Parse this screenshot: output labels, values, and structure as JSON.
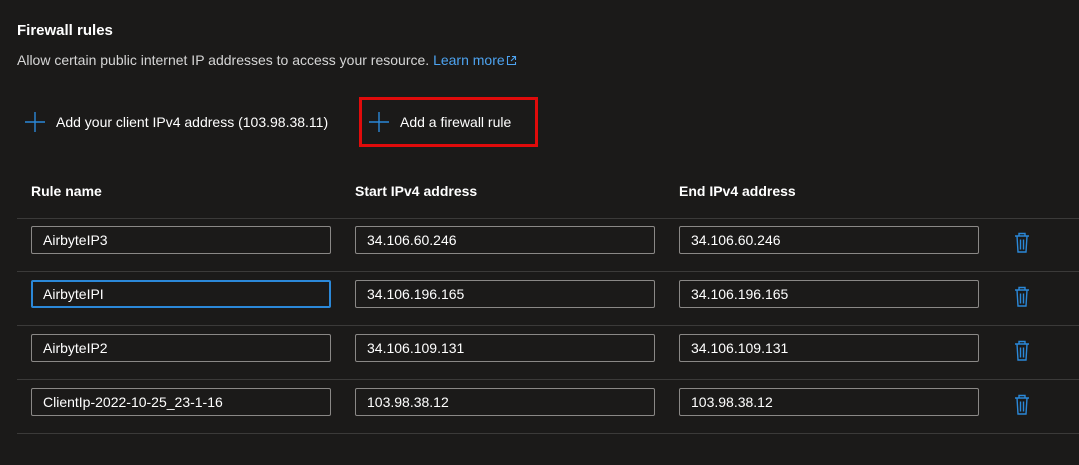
{
  "section": {
    "title": "Firewall rules",
    "description": "Allow certain public internet IP addresses to access your resource.",
    "learn_more": "Learn more"
  },
  "commands": {
    "add_client_ip": "Add your client IPv4 address (103.98.38.11)",
    "add_firewall_rule": "Add a firewall rule"
  },
  "table": {
    "headers": [
      "Rule name",
      "Start IPv4 address",
      "End IPv4 address"
    ],
    "rows": [
      {
        "name": "AirbyteIP3",
        "start": "34.106.60.246",
        "end": "34.106.60.246"
      },
      {
        "name": "AirbyteIPI",
        "start": "34.106.196.165",
        "end": "34.106.196.165"
      },
      {
        "name": "AirbyteIP2",
        "start": "34.106.109.131",
        "end": "34.106.109.131"
      },
      {
        "name": "ClientIp-2022-10-25_23-1-16",
        "start": "103.98.38.12",
        "end": "103.98.38.12"
      }
    ]
  },
  "colors": {
    "accent": "#4da3f0",
    "icon_blue": "#2b88d8",
    "highlight": "#e00b0b",
    "background": "#1b1a19"
  },
  "icons": {
    "add": "plus-icon",
    "delete": "trash-icon",
    "external_link": "external-link-icon"
  }
}
